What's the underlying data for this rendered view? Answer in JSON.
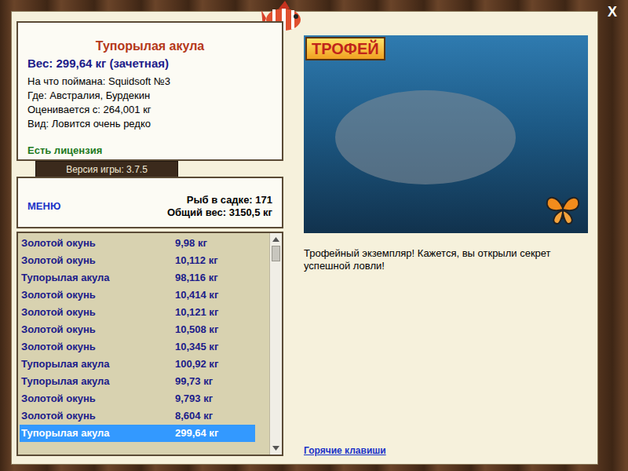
{
  "fish": {
    "name": "Тупорылая акула",
    "weight": "Вес: 299,64 кг (зачетная)",
    "details": [
      "На что поймана: Squidsoft №3",
      "Где: Австралия, Бурдекин",
      "Оценивается с: 264,001 кг",
      "Вид: Ловится очень редко"
    ],
    "license": "Есть лицензия"
  },
  "version": "Версия игры: 3.7.5",
  "menu": "МЕНЮ",
  "keepnet": {
    "count": "Рыб в садке: 171",
    "total": "Общий вес: 3150,5 кг"
  },
  "catches": [
    {
      "name": "Золотой окунь",
      "weight": "9,98 кг",
      "selected": false
    },
    {
      "name": "Золотой окунь",
      "weight": "10,112 кг",
      "selected": false
    },
    {
      "name": "Тупорылая акула",
      "weight": "98,116 кг",
      "selected": false
    },
    {
      "name": "Золотой окунь",
      "weight": "10,414 кг",
      "selected": false
    },
    {
      "name": "Золотой окунь",
      "weight": "10,121 кг",
      "selected": false
    },
    {
      "name": "Золотой окунь",
      "weight": "10,508 кг",
      "selected": false
    },
    {
      "name": "Золотой окунь",
      "weight": "10,345 кг",
      "selected": false
    },
    {
      "name": "Тупорылая акула",
      "weight": "100,92 кг",
      "selected": false
    },
    {
      "name": "Тупорылая акула",
      "weight": "99,73 кг",
      "selected": false
    },
    {
      "name": "Золотой окунь",
      "weight": "9,793 кг",
      "selected": false
    },
    {
      "name": "Золотой окунь",
      "weight": "8,604 кг",
      "selected": false
    },
    {
      "name": "Тупорылая акула",
      "weight": "299,64 кг",
      "selected": true
    }
  ],
  "scrollbar": {
    "level": 0.95
  },
  "trophy_badge": "ТРОФЕЙ",
  "message": "Трофейный экземпляр! Кажется, вы открыли секрет успешной ловли!",
  "hotkeys": "Горячие клавиши",
  "close": "X"
}
